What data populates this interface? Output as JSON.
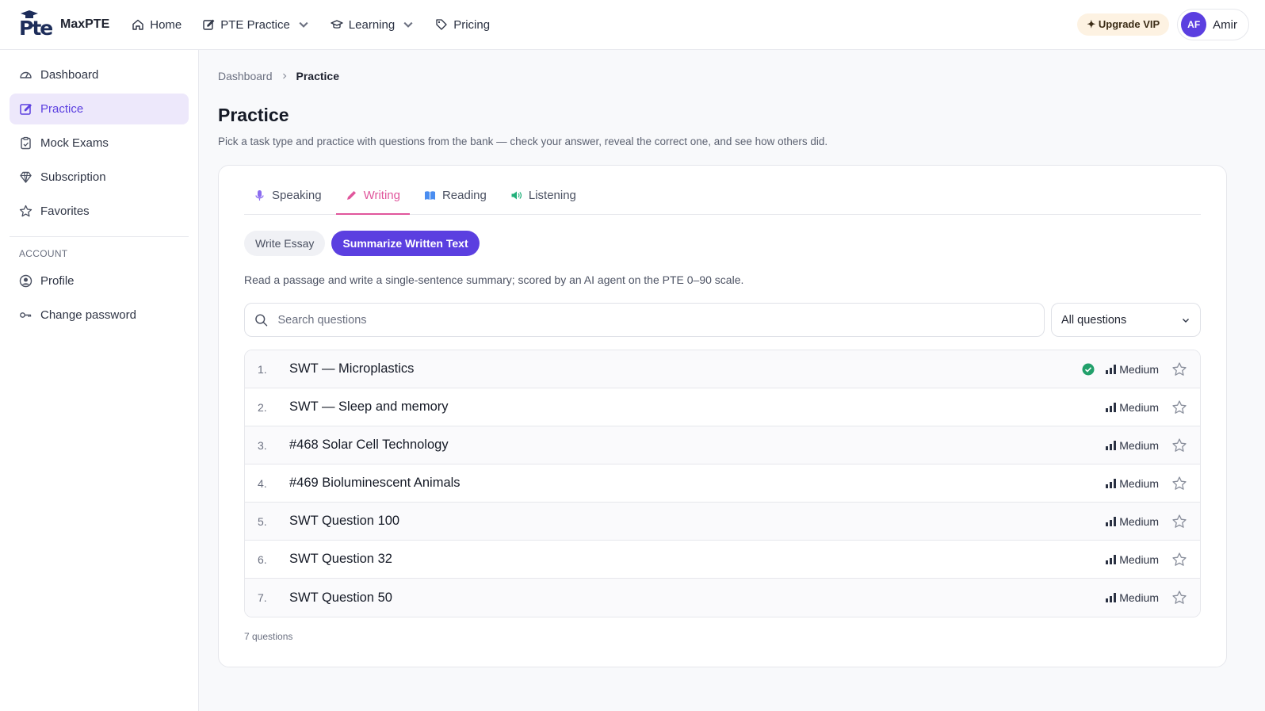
{
  "header": {
    "logo_letters": "Pte",
    "brand": "MaxPTE",
    "nav": [
      {
        "label": "Home",
        "icon": "home-icon"
      },
      {
        "label": "PTE Practice",
        "icon": "edit-icon",
        "dropdown": true
      },
      {
        "label": "Learning",
        "icon": "graduation-cap-icon",
        "dropdown": true
      },
      {
        "label": "Pricing",
        "icon": "tag-icon"
      }
    ],
    "upgrade_label": "✦ Upgrade VIP",
    "user_initials": "AF",
    "user_name": "Amir"
  },
  "sidebar": {
    "items": [
      {
        "label": "Dashboard",
        "icon": "gauge-icon",
        "active": false
      },
      {
        "label": "Practice",
        "icon": "edit-icon",
        "active": true
      },
      {
        "label": "Mock Exams",
        "icon": "clipboard-icon",
        "active": false
      },
      {
        "label": "Subscription",
        "icon": "diamond-icon",
        "active": false
      },
      {
        "label": "Favorites",
        "icon": "star-icon",
        "active": false
      }
    ],
    "section_label": "ACCOUNT",
    "account_items": [
      {
        "label": "Profile",
        "icon": "user-circle-icon"
      },
      {
        "label": "Change password",
        "icon": "key-icon"
      }
    ]
  },
  "breadcrumb": {
    "parent": "Dashboard",
    "current": "Practice"
  },
  "page": {
    "title": "Practice",
    "description": "Pick a task type and practice with questions from the bank — check your answer, reveal the correct one, and see how others did."
  },
  "tabs": [
    {
      "label": "Speaking",
      "icon": "microphone-icon",
      "active": false
    },
    {
      "label": "Writing",
      "icon": "pencil-icon",
      "active": true
    },
    {
      "label": "Reading",
      "icon": "book-icon",
      "active": false
    },
    {
      "label": "Listening",
      "icon": "speaker-icon",
      "active": false
    }
  ],
  "subtabs": [
    {
      "label": "Write Essay",
      "active": false
    },
    {
      "label": "Summarize Written Text",
      "active": true
    }
  ],
  "task_description": "Read a passage and write a single-sentence summary; scored by an AI agent on the PTE 0–90 scale.",
  "search": {
    "placeholder": "Search questions",
    "value": ""
  },
  "filter": {
    "selected": "All questions"
  },
  "questions": [
    {
      "num": "1.",
      "title": "SWT — Microplastics",
      "difficulty": "Medium",
      "completed": true
    },
    {
      "num": "2.",
      "title": "SWT — Sleep and memory",
      "difficulty": "Medium",
      "completed": false
    },
    {
      "num": "3.",
      "title": "#468 Solar Cell Technology",
      "difficulty": "Medium",
      "completed": false
    },
    {
      "num": "4.",
      "title": "#469 Bioluminescent Animals",
      "difficulty": "Medium",
      "completed": false
    },
    {
      "num": "5.",
      "title": "SWT Question 100",
      "difficulty": "Medium",
      "completed": false
    },
    {
      "num": "6.",
      "title": "SWT Question 32",
      "difficulty": "Medium",
      "completed": false
    },
    {
      "num": "7.",
      "title": "SWT Question 50",
      "difficulty": "Medium",
      "completed": false
    }
  ],
  "question_count": "7 questions",
  "colors": {
    "accent": "#5b3fe0",
    "writing_tab": "#e0569c",
    "completed": "#22a06b",
    "upgrade_bg": "#fdf2e2"
  }
}
